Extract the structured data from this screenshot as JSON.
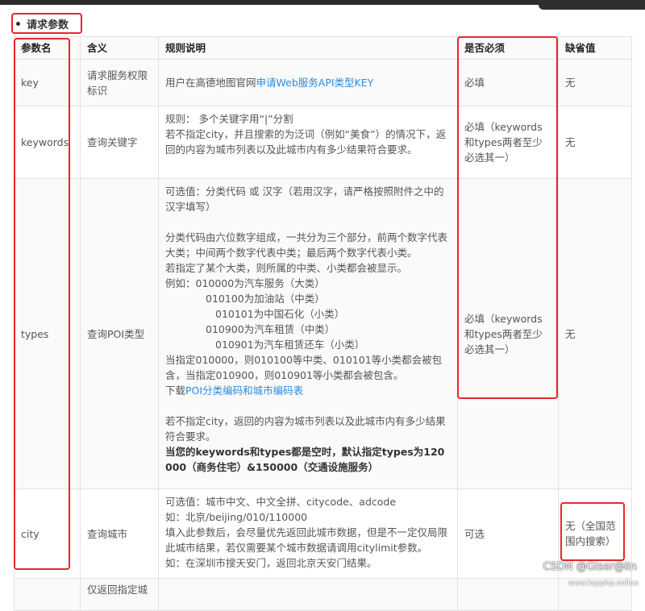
{
  "section_title": "请求参数",
  "headers": [
    "参数名",
    "含义",
    "规则说明",
    "是否必须",
    "缺省值"
  ],
  "rows": [
    {
      "name": "key",
      "meaning": "请求服务权限标识",
      "rule_prefix": "用户在高德地图官网",
      "rule_link": "申请Web服务API类型KEY",
      "required": "必填",
      "default": "无"
    },
    {
      "name": "keywords",
      "meaning": "查询关键字",
      "rule_lines": [
        "规则： 多个关键字用“|”分割",
        "若不指定city，并且搜索的为泛词（例如“美食”）的情况下，返回的内容为城市列表以及此城市内有多少结果符合要求。"
      ],
      "required": "必填（keywords和types两者至少必选其一）",
      "default": "无"
    },
    {
      "name": "types",
      "meaning": "查询POI类型",
      "rule_p1": "可选值：分类代码 或 汉字（若用汉字，请严格按照附件之中的汉字填写）",
      "rule_p2": [
        "分类代码由六位数字组成，一共分为三个部分，前两个数字代表大类；中间两个数字代表中类；最后两个数字代表小类。",
        "若指定了某个大类，则所属的中类、小类都会被显示。",
        "例如：010000为汽车服务（大类）",
        "010100为加油站（中类）",
        "010101为中国石化（小类）",
        "010900为汽车租赁（中类）",
        "010901为汽车租赁还车（小类）",
        "当指定010000，则010100等中类、010101等小类都会被包含，当指定010900，则010901等小类都会被包含。"
      ],
      "rule_download_prefix": "下载",
      "rule_download_link": "POI分类编码和城市编码表",
      "rule_p3": "若不指定city，返回的内容为城市列表以及此城市内有多少结果符合要求。",
      "rule_bold": "当您的keywords和types都是空时，默认指定types为120000（商务住宅）&150000（交通设施服务）",
      "required": "必填（keywords和types两者至少必选其一）",
      "default": "无"
    },
    {
      "name": "city",
      "meaning": "查询城市",
      "rule_lines": [
        "可选值：城市中文、中文全拼、citycode、adcode",
        "如：北京/beijing/010/110000",
        "填入此参数后，会尽量优先返回此城市数据，但是不一定仅局限此城市结果，若仅需要某个城市数据请调用citylimit参数。",
        "如：在深圳市搜天安门，返回北京天安门结果。"
      ],
      "required": "可选",
      "default": "无（全国范围内搜索）"
    },
    {
      "name": "",
      "meaning": "仅返回指定城",
      "rule_lines": [],
      "required": "",
      "default": ""
    }
  ],
  "watermark": "CSDN @Giser@lin",
  "watermark_sub": "www.kspphp.online",
  "accent_colors": {
    "highlight_box": "#e8262b",
    "link": "#2a8be0"
  }
}
